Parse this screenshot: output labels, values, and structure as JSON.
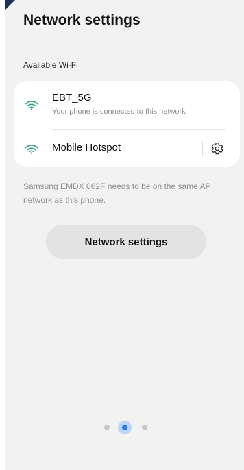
{
  "header": {
    "title": "Network settings"
  },
  "available_wifi": {
    "section_label": "Available Wi-Fi",
    "networks": [
      {
        "name": "EBT_5G",
        "status": "Your phone is connected to this network",
        "icon": "wifi-icon"
      },
      {
        "name": "Mobile Hotspot",
        "icon": "wifi-icon",
        "action_icon": "gear-icon"
      }
    ]
  },
  "info": {
    "text": "Samsung EMDX 062F needs to be on the same AP network as this phone."
  },
  "actions": {
    "network_settings_label": "Network settings"
  },
  "pager": {
    "total": 3,
    "current": 2
  },
  "colors": {
    "background": "#f2f2f2",
    "card": "#ffffff",
    "wifi_icon": "#2f9e8f",
    "accent_dot": "#2e7bea",
    "button_bg": "#e3e3e3"
  }
}
